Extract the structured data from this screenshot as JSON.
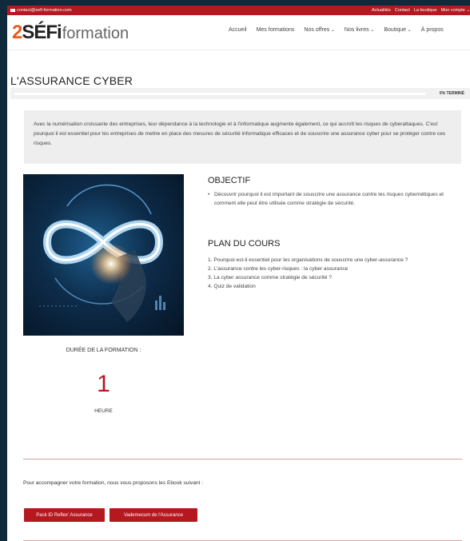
{
  "topbar": {
    "email": "contact@sefi-formation.com",
    "links": [
      "Actualités",
      "Contact",
      "La boutique",
      "Mon compte"
    ]
  },
  "logo": {
    "part1": "2",
    "part2": "SÉFi",
    "part3": "formation"
  },
  "nav": [
    {
      "label": "Accueil",
      "dropdown": false
    },
    {
      "label": "Mes formations",
      "dropdown": false
    },
    {
      "label": "Nos offres",
      "dropdown": true
    },
    {
      "label": "Nos livres",
      "dropdown": true
    },
    {
      "label": "Boutique",
      "dropdown": true
    },
    {
      "label": "À propos",
      "dropdown": false
    }
  ],
  "page_title": "L'ASSURANCE CYBER",
  "progress": {
    "percent": 0,
    "label": "0% TERMINÉ"
  },
  "intro": "Avec la numérisation croissante des entreprises, leur dépendance à la technologie et à l'informatique augmente également, ce qui accroît les risques de cyberattaques. C'est pourquoi il est essentiel pour les entreprises de mettre en place des mesures de sécurité informatique efficaces et de souscrire une assurance cyber pour se protéger contre ces risques.",
  "duree": {
    "label": "DURÉE DE LA FORMATION :",
    "value": "1",
    "unit": "HEURE"
  },
  "objectif": {
    "title": "OBJECTIF",
    "items": [
      "Découvrir pourquoi il est important de souscrire une assurance contre les risques cybernétiques et comment elle peut être utilisée comme stratégie de sécurité."
    ]
  },
  "plan": {
    "title": "PLAN DU COURS",
    "items": [
      "1. Pourquoi est-il essentiel pour les organisations de souscrire une cyber-assurance ?",
      "2. L'assurance contre les cyber-risques : la cyber assurance",
      "3. La cyber assurance comme stratégie de sécurité ?",
      "4. Quiz de validation"
    ]
  },
  "ebook_text": "Pour accompagner votre formation, nous vous proposons les Ebook suivant :",
  "buttons": [
    "Pack ID Reflex' Assurance",
    "Vademecum de l'Assurance"
  ],
  "colors": {
    "accent": "#b5181f",
    "logo_orange": "#e85a1f",
    "background": "#0f2a3a"
  }
}
